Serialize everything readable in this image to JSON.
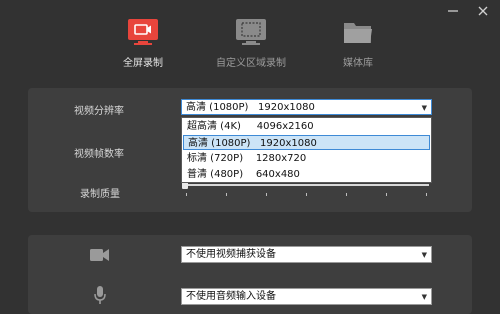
{
  "tabs": [
    {
      "label": "全屏录制",
      "icon": "fullscreen-record-icon",
      "active": true
    },
    {
      "label": "自定义区域录制",
      "icon": "region-record-icon",
      "active": false
    },
    {
      "label": "媒体库",
      "icon": "folder-icon",
      "active": false
    }
  ],
  "settings": {
    "resolution_label": "视频分辨率",
    "resolution_value": "高清 (1080P)   1920x1080",
    "framerate_label": "视频帧数率",
    "quality_label": "录制质量",
    "quality_level": 0.0
  },
  "resolution_options": [
    "超高清 (4K)     4096x2160",
    "高清 (1080P)   1920x1080",
    "标清 (720P)    1280x720",
    "普清 (480P)    640x480"
  ],
  "devices": {
    "camera_value": "不使用视频捕获设备",
    "mic_value": "不使用音频输入设备"
  },
  "colors": {
    "accent": "#e8453c",
    "icon_inactive": "#8a8a8a"
  }
}
